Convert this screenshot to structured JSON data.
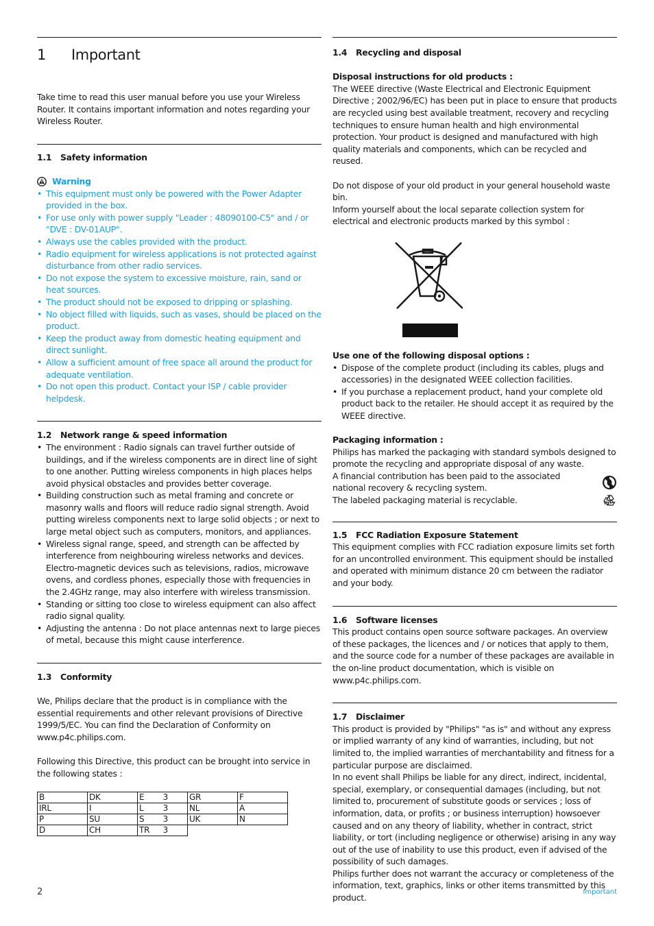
{
  "chapter": {
    "number": "1",
    "title": "Important"
  },
  "intro": "Take time to read this user manual before you use your Wireless Router. It contains important information and notes regarding your Wireless Router.",
  "s1_1": {
    "number": "1.1",
    "title": "Safety information",
    "warning_title": "Warning",
    "warning_icon": "warning-triangle-icon",
    "items": [
      "This equipment must only be powered with the Power Adapter provided in the box.",
      "For use only with power supply \"Leader : 48090100-C5\" and / or \"DVE : DV-01AUP\".",
      "Always use the cables provided with the product.",
      "Radio equipment for wireless applications is not protected against disturbance from other radio services.",
      "Do not expose the system to excessive moisture, rain, sand or heat sources.",
      "The product should not be exposed to dripping or splashing.",
      "No object filled with liquids, such as vases, should be placed on the product.",
      "Keep the product away from domestic heating equipment and direct sunlight.",
      "Allow a sufficient amount of free space all around the product for adequate ventilation.",
      "Do not open this product. Contact your ISP / cable provider helpdesk."
    ]
  },
  "s1_2": {
    "number": "1.2",
    "title": "Network range & speed information",
    "items": [
      "The environment : Radio signals can travel further outside of buildings, and if the wireless components are in direct line of sight to one another. Putting wireless components in high places helps avoid physical obstacles and provides better coverage.",
      "Building construction such as metal framing and concrete or masonry walls and floors will reduce radio signal strength. Avoid putting wireless components next to large solid objects ; or next to large metal object such as computers, monitors, and appliances.",
      "Wireless signal range, speed, and strength can be affected by interference from neighbouring wireless networks and devices. Electro-magnetic devices such as televisions, radios, microwave ovens, and cordless phones, especially those with frequencies in the 2.4GHz range, may also interfere with wireless transmission.",
      "Standing or sitting too close to wireless equipment can also affect radio signal quality.",
      "Adjusting the antenna : Do not place antennas next to large pieces of metal, because this might cause interference."
    ]
  },
  "s1_3": {
    "number": "1.3",
    "title": "Conformity",
    "p1": "We, Philips declare that the product is in compliance with the essential requirements and other relevant provisions of Directive 1999/5/EC. You can find the Declaration of Conformity on www.p4c.philips.com.",
    "p2": "Following this Directive, this product can be brought into service in the following states :",
    "states": [
      [
        {
          "c": "B",
          "n": ""
        },
        {
          "c": "DK",
          "n": ""
        },
        {
          "c": "E",
          "n": "3"
        },
        {
          "c": "GR",
          "n": ""
        },
        {
          "c": "F",
          "n": ""
        }
      ],
      [
        {
          "c": "IRL",
          "n": ""
        },
        {
          "c": "I",
          "n": ""
        },
        {
          "c": "L",
          "n": "3"
        },
        {
          "c": "NL",
          "n": ""
        },
        {
          "c": "A",
          "n": ""
        }
      ],
      [
        {
          "c": "P",
          "n": ""
        },
        {
          "c": "SU",
          "n": ""
        },
        {
          "c": "S",
          "n": "3"
        },
        {
          "c": "UK",
          "n": ""
        },
        {
          "c": "N",
          "n": ""
        }
      ],
      [
        {
          "c": "D",
          "n": ""
        },
        {
          "c": "CH",
          "n": ""
        },
        {
          "c": "TR",
          "n": "3"
        }
      ]
    ]
  },
  "s1_4": {
    "number": "1.4",
    "title": "Recycling and disposal",
    "disposal_head": "Disposal instructions for old products :",
    "disposal_p1": "The WEEE directive (Waste Electrical and Electronic Equipment Directive ; 2002/96/EC) has been put in place to ensure that products are recycled using best available treatment, recovery and recycling techniques to ensure human health and high environmental protection. Your product is designed and manufactured with high quality materials and components, which can be recycled and reused.",
    "disposal_p2": "Do not dispose of your old product in your general household waste bin.",
    "disposal_p3": "Inform yourself about the local separate collection system for electrical and electronic products marked by this symbol :",
    "weee_icon": "crossed-out-wheelie-bin-icon",
    "options_head": "Use one of the following disposal options :",
    "options": [
      "Dispose of the complete product (including its cables, plugs and accessories) in the designated WEEE collection facilities.",
      "If you purchase a replacement product, hand your complete old product back to the retailer. He should accept it as required by the WEEE directive."
    ],
    "packaging_head": "Packaging information :",
    "packaging_p1": "Philips has marked the packaging with standard symbols designed to promote the recycling and appropriate disposal of any waste.",
    "packaging_p2": "A financial contribution has been paid to the associated national recovery & recycling system.",
    "packaging_p3": "The labeled packaging material is recyclable."
  },
  "s1_5": {
    "number": "1.5",
    "title": "FCC Radiation Exposure Statement",
    "p": "This equipment complies with FCC radiation exposure limits set forth for an uncontrolled environment. This equipment should be installed and operated with minimum distance 20 cm between the radiator and your body."
  },
  "s1_6": {
    "number": "1.6",
    "title": "Software licenses",
    "p": "This product contains open source software packages. An overview of these packages, the licences and / or notices that apply to them, and the source code for a number of these packages are available in the on-line product documentation, which is visible on www.p4c.philips.com."
  },
  "s1_7": {
    "number": "1.7",
    "title": "Disclaimer",
    "p1": "This product is provided by \"Philips\" \"as is\" and without any express or implied warranty of any kind of warranties, including, but not limited to, the implied warranties of merchantability and fitness for a particular purpose are disclaimed.",
    "p2": "In no event shall Philips be liable for any direct, indirect, incidental, special, exemplary, or consequential damages (including, but not limited to, procurement of substitute goods or services ; loss of information, data, or profits ; or business interruption) howsoever caused and on any theory of liability, whether in contract, strict liability, or tort (including negligence or otherwise) arising in any way out of the use of inability to use this product, even if advised of the possibility of such damages.",
    "p3": "Philips further does not warrant the accuracy or completeness of the information, text, graphics, links or other items transmitted by this product."
  },
  "footer": {
    "page_number": "2",
    "section": "Important"
  },
  "colors": {
    "accent": "#1e9fd8",
    "text": "#1a1a1a"
  }
}
